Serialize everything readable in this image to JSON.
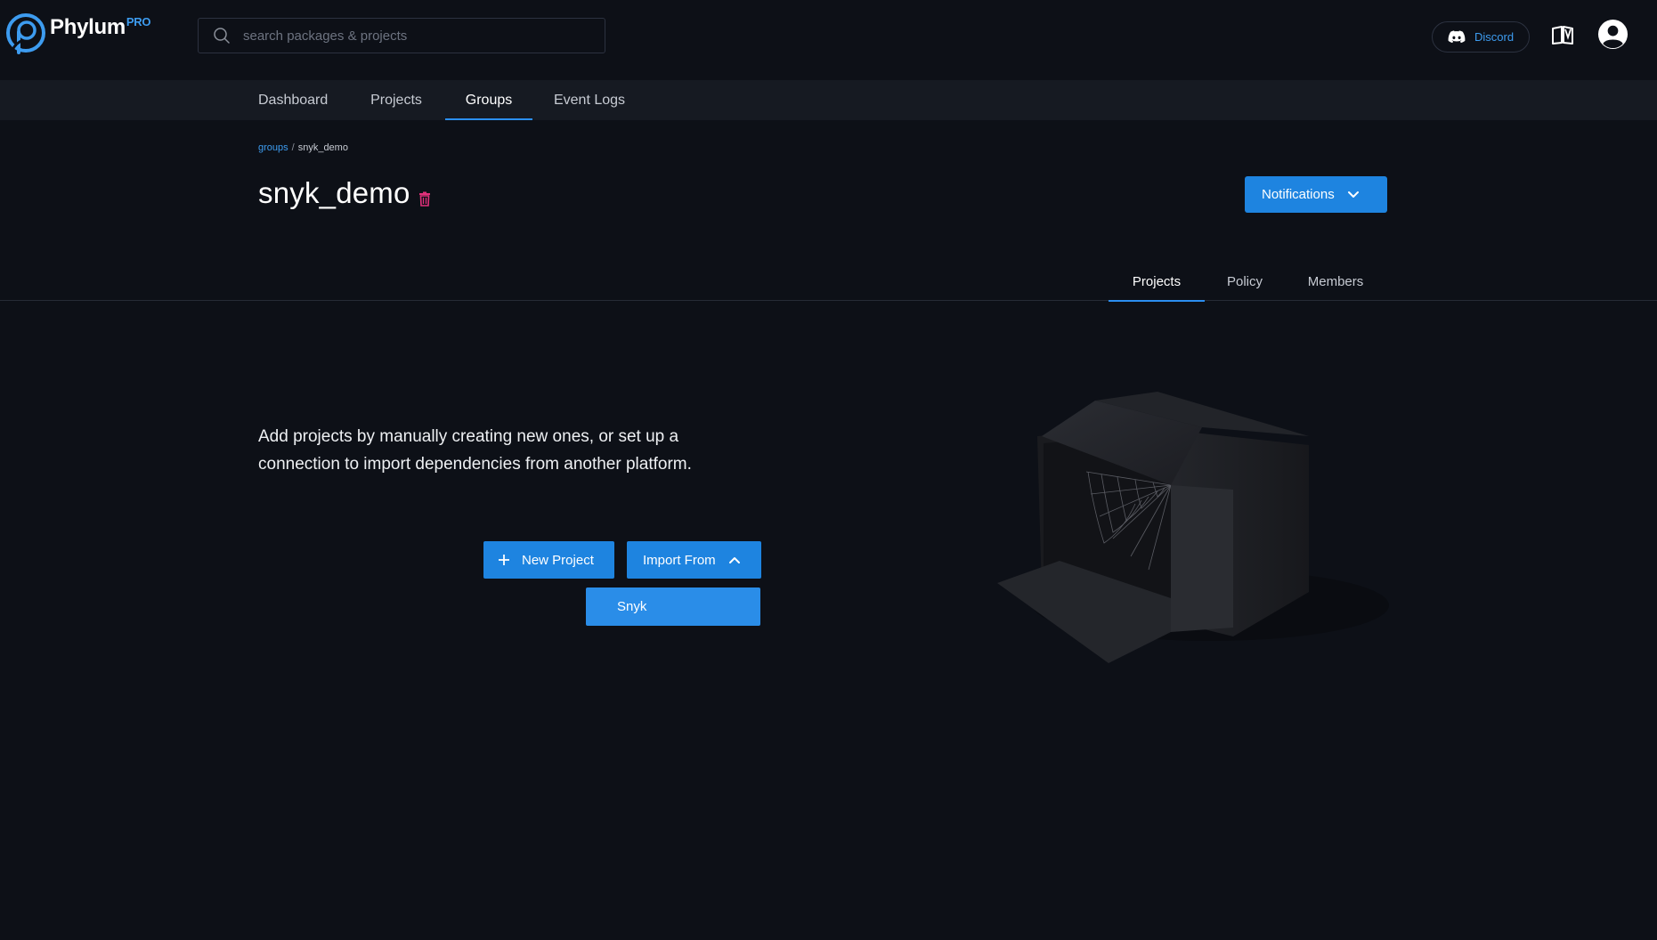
{
  "header": {
    "brand": "Phylum",
    "brand_tier": "PRO",
    "search_placeholder": "search packages & projects",
    "discord_label": "Discord"
  },
  "nav": {
    "items": [
      {
        "label": "Dashboard"
      },
      {
        "label": "Projects"
      },
      {
        "label": "Groups"
      },
      {
        "label": "Event Logs"
      }
    ],
    "active": "Groups"
  },
  "breadcrumb": {
    "root": "groups",
    "separator": "/",
    "current": "snyk_demo"
  },
  "page": {
    "title": "snyk_demo",
    "notifications_label": "Notifications"
  },
  "subtabs": {
    "items": [
      {
        "label": "Projects"
      },
      {
        "label": "Policy"
      },
      {
        "label": "Members"
      }
    ],
    "active": "Projects"
  },
  "empty_state": {
    "message": "Add projects by manually creating new ones, or set up a connection to import dependencies from another platform.",
    "new_project_label": "New Project",
    "import_from_label": "Import From",
    "import_options": [
      "Snyk"
    ]
  },
  "colors": {
    "background": "#0d1017",
    "nav_background": "#161a22",
    "accent": "#1e84e0",
    "link": "#3d9cf0",
    "danger": "#e0307a"
  },
  "icons": {
    "logo": "phylum-logo-icon",
    "search": "search-icon",
    "discord": "discord-icon",
    "docs": "docs-book-icon",
    "account": "user-avatar-icon",
    "delete": "trash-icon",
    "dropdown": "chevron-down-icon",
    "collapse": "chevron-up-icon",
    "add": "plus-icon"
  }
}
